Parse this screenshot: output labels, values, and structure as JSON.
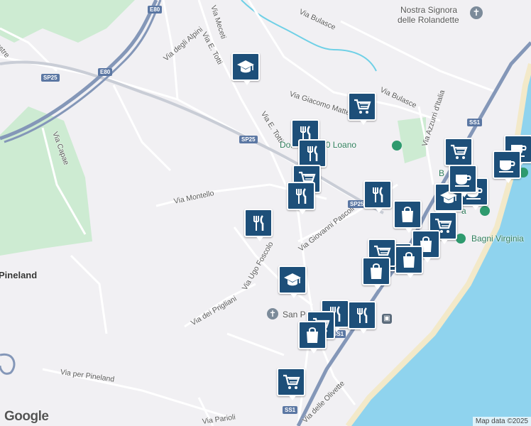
{
  "map": {
    "road_labels": [
      {
        "id": "via-bulasce-1",
        "text": "Via Bulasce"
      },
      {
        "id": "via-bulasce-2",
        "text": "Via Bulasce"
      },
      {
        "id": "via-giacomo-matteotti",
        "text": "Via Giacomo Matteotti"
      },
      {
        "id": "via-e-totti-1",
        "text": "Via E. Totti"
      },
      {
        "id": "via-e-totti-2",
        "text": "Via E. Totti"
      },
      {
        "id": "via-meceti",
        "text": "Via Meceti"
      },
      {
        "id": "via-degli-alpini",
        "text": "Via degli Alpini"
      },
      {
        "id": "via-capae",
        "text": "Via Capae"
      },
      {
        "id": "via-montello",
        "text": "Via Montello"
      },
      {
        "id": "via-giovanni-pascoli",
        "text": "Via Giovanni Pascoli"
      },
      {
        "id": "via-ugo-foscolo",
        "text": "Via Ugo Foscolo"
      },
      {
        "id": "via-dei-prigliani",
        "text": "Via dei Prigliani"
      },
      {
        "id": "via-per-pineland",
        "text": "Via per Pineland"
      },
      {
        "id": "via-delle-olivette",
        "text": "Via delle Olivette"
      },
      {
        "id": "via-parioli",
        "text": "Via Parioli"
      },
      {
        "id": "via-azzurri-ditalia",
        "text": "Via Azzurri d'Italia"
      },
      {
        "id": "edge-label",
        "text": "estre"
      }
    ],
    "route_shields": [
      {
        "id": "e80-top",
        "text": "E80"
      },
      {
        "id": "e80-mid",
        "text": "E80"
      },
      {
        "id": "sp25-left",
        "text": "SP25"
      },
      {
        "id": "sp25-mid",
        "text": "SP25"
      },
      {
        "id": "sp25-right",
        "text": "SP25"
      },
      {
        "id": "ss1-top",
        "text": "SS1"
      },
      {
        "id": "ss1-mid",
        "text": "SS1"
      },
      {
        "id": "ss1-bottom",
        "text": "SS1"
      }
    ],
    "place_labels": {
      "nostra_signora_line1": "Nostra Signora",
      "nostra_signora_line2": "delle Rolandette",
      "domino_2000": "Domino 2000 Loano",
      "bagni_virginia": "Bagni Virginia",
      "bagni_partial": "B",
      "bagni_partial2": "a",
      "san_p": "San P",
      "pineland": "Pineland"
    },
    "markers": [
      {
        "id": "school-top",
        "icon": "graduation-cap"
      },
      {
        "id": "cart-matteotti",
        "icon": "shopping-cart"
      },
      {
        "id": "fork-totti",
        "icon": "restaurant"
      },
      {
        "id": "fork-domino",
        "icon": "restaurant"
      },
      {
        "id": "cart-centre",
        "icon": "shopping-cart"
      },
      {
        "id": "fork-centre",
        "icon": "restaurant"
      },
      {
        "id": "fork-pascoli",
        "icon": "restaurant"
      },
      {
        "id": "fork-montello",
        "icon": "restaurant"
      },
      {
        "id": "cart-right",
        "icon": "shopping-cart"
      },
      {
        "id": "cafe-right",
        "icon": "coffee-cup"
      },
      {
        "id": "cafe-right2",
        "icon": "coffee-cup"
      },
      {
        "id": "cafe-far-right",
        "icon": "coffee-cup"
      },
      {
        "id": "school-right",
        "icon": "graduation-cap"
      },
      {
        "id": "cafe-cluster",
        "icon": "coffee-cup"
      },
      {
        "id": "shop-cluster-1",
        "icon": "shopping-bag"
      },
      {
        "id": "cart-cluster-1",
        "icon": "shopping-cart"
      },
      {
        "id": "shop-cluster-2",
        "icon": "shopping-bag"
      },
      {
        "id": "cart-cluster-2",
        "icon": "shopping-cart"
      },
      {
        "id": "shop-cluster-3",
        "icon": "shopping-bag"
      },
      {
        "id": "cart-cluster-3",
        "icon": "shopping-cart"
      },
      {
        "id": "shop-cluster-4",
        "icon": "shopping-bag"
      },
      {
        "id": "school-bottom",
        "icon": "graduation-cap"
      },
      {
        "id": "fork-station-1",
        "icon": "restaurant"
      },
      {
        "id": "fork-station-2",
        "icon": "restaurant"
      },
      {
        "id": "cart-station",
        "icon": "shopping-cart"
      },
      {
        "id": "shop-station",
        "icon": "shopping-bag"
      },
      {
        "id": "cart-bottom",
        "icon": "shopping-cart"
      }
    ],
    "colors": {
      "background": "#f1f0f3",
      "sea": "#8fd3ee",
      "park": "#cdebd2",
      "highway": "#8497b8",
      "marker": "#1d4f79",
      "water_line": "#6fd0e6"
    }
  },
  "branding": {
    "logo": "Google"
  },
  "attribution": "Map data ©2025"
}
